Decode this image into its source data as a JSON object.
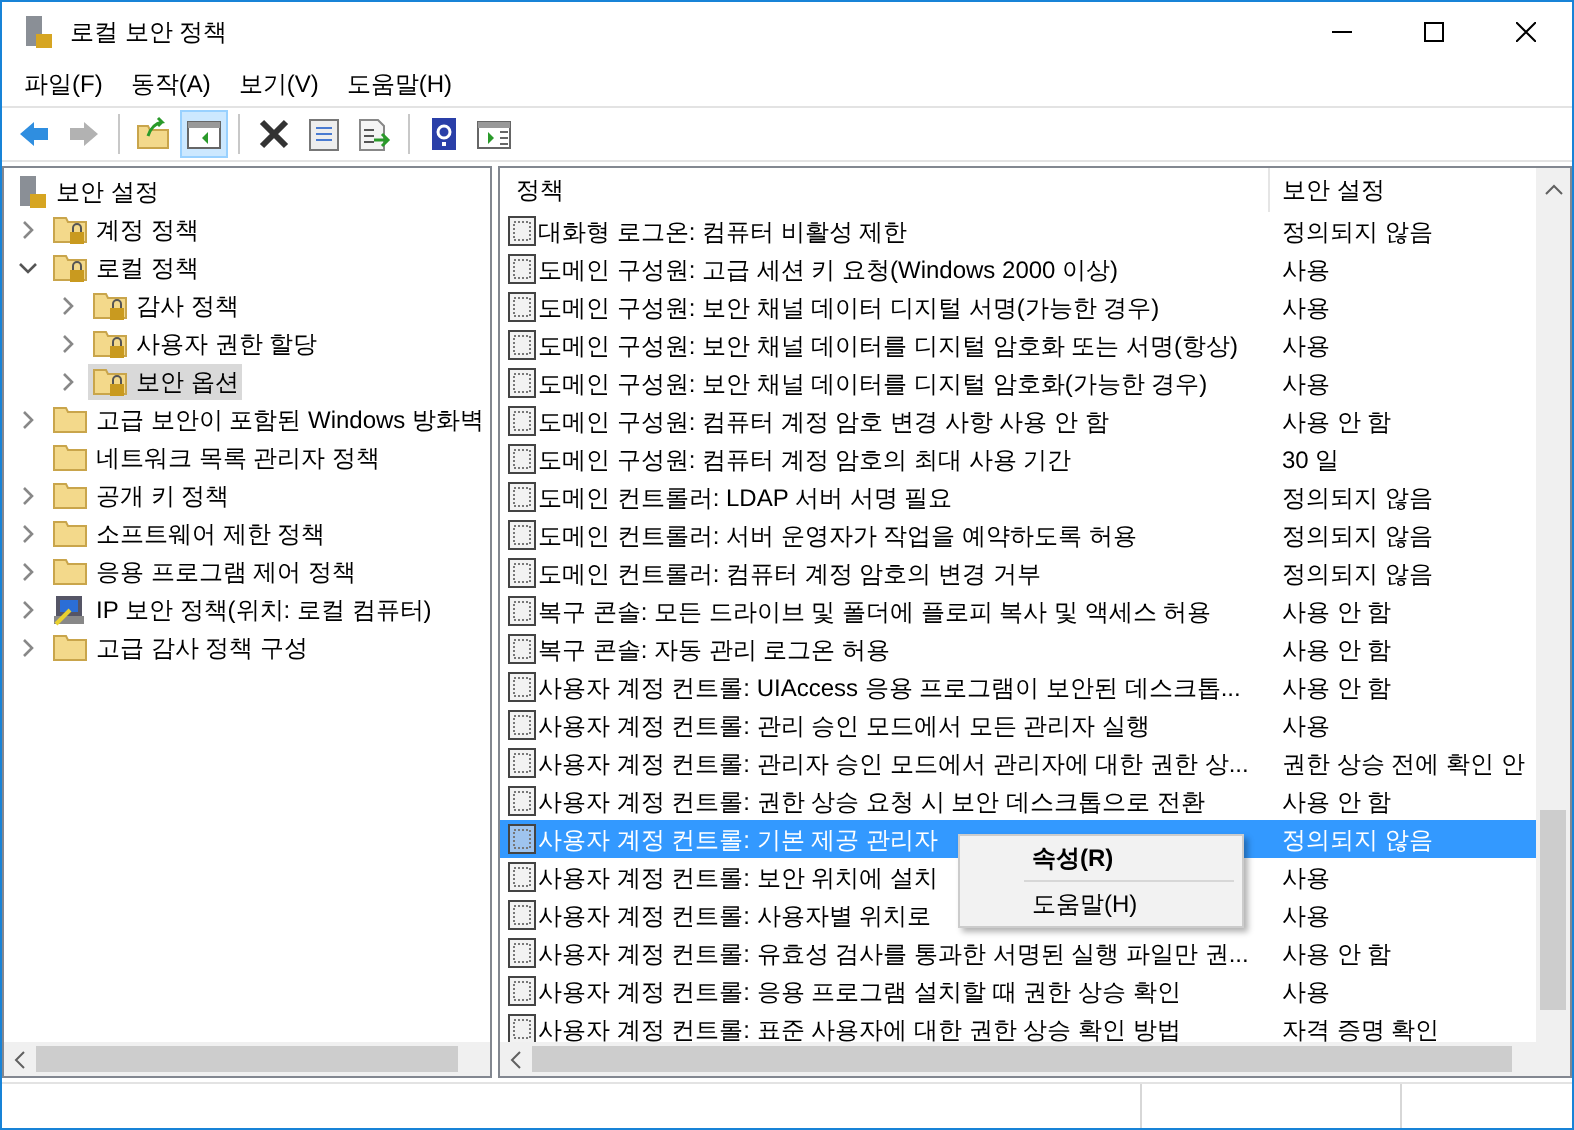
{
  "window": {
    "title": "로컬 보안 정책"
  },
  "menu": [
    "파일(F)",
    "동작(A)",
    "보기(V)",
    "도움말(H)"
  ],
  "toolbar": [
    [
      {
        "kind": "back",
        "disabled": false,
        "pressed": false
      },
      {
        "kind": "forward",
        "disabled": true,
        "pressed": false
      }
    ],
    [
      {
        "kind": "up",
        "disabled": false,
        "pressed": false
      },
      {
        "kind": "tree",
        "disabled": false,
        "pressed": true
      }
    ],
    [
      {
        "kind": "delete",
        "disabled": false,
        "pressed": false
      },
      {
        "kind": "properties",
        "disabled": false,
        "pressed": false
      },
      {
        "kind": "export",
        "disabled": false,
        "pressed": false
      }
    ],
    [
      {
        "kind": "help",
        "disabled": false,
        "pressed": false
      },
      {
        "kind": "action",
        "disabled": false,
        "pressed": false
      }
    ]
  ],
  "tree": {
    "label": "보안 설정",
    "children": [
      {
        "label": "계정 정책",
        "kind": "lockfolder",
        "expandable": true,
        "expanded": false,
        "selected": false
      },
      {
        "label": "로컬 정책",
        "kind": "lockfolder",
        "expandable": true,
        "expanded": true,
        "selected": false,
        "children": [
          {
            "label": "감사 정책",
            "kind": "lockfolder",
            "expandable": true,
            "expanded": false,
            "selected": false
          },
          {
            "label": "사용자 권한 할당",
            "kind": "lockfolder",
            "expandable": true,
            "expanded": false,
            "selected": false
          },
          {
            "label": "보안 옵션",
            "kind": "lockfolder",
            "expandable": true,
            "expanded": false,
            "selected": true
          }
        ]
      },
      {
        "label": "고급 보안이 포함된 Windows 방화벽",
        "kind": "folder",
        "expandable": true,
        "expanded": false,
        "selected": false
      },
      {
        "label": "네트워크 목록 관리자 정책",
        "kind": "folder",
        "expandable": false,
        "selected": false
      },
      {
        "label": "공개 키 정책",
        "kind": "folder",
        "expandable": true,
        "expanded": false,
        "selected": false
      },
      {
        "label": "소프트웨어 제한 정책",
        "kind": "folder",
        "expandable": true,
        "expanded": false,
        "selected": false
      },
      {
        "label": "응용 프로그램 제어 정책",
        "kind": "folder",
        "expandable": true,
        "expanded": false,
        "selected": false
      },
      {
        "label": "IP 보안 정책(위치: 로컬 컴퓨터)",
        "kind": "ip",
        "expandable": true,
        "expanded": false,
        "selected": false
      },
      {
        "label": "고급 감사 정책 구성",
        "kind": "folder",
        "expandable": true,
        "expanded": false,
        "selected": false
      }
    ]
  },
  "table": {
    "columns": [
      "정책",
      "보안 설정"
    ],
    "rows": [
      {
        "policy": "대화형 로그온: 컴퓨터 비활성 제한",
        "setting": "정의되지 않음",
        "selected": false
      },
      {
        "policy": "도메인 구성원: 고급 세션 키 요청(Windows 2000 이상)",
        "setting": "사용",
        "selected": false
      },
      {
        "policy": "도메인 구성원: 보안 채널 데이터 디지털 서명(가능한 경우)",
        "setting": "사용",
        "selected": false
      },
      {
        "policy": "도메인 구성원: 보안 채널 데이터를 디지털 암호화 또는 서명(항상)",
        "setting": "사용",
        "selected": false
      },
      {
        "policy": "도메인 구성원: 보안 채널 데이터를 디지털 암호화(가능한 경우)",
        "setting": "사용",
        "selected": false
      },
      {
        "policy": "도메인 구성원: 컴퓨터 계정 암호 변경 사항 사용 안 함",
        "setting": "사용 안 함",
        "selected": false
      },
      {
        "policy": "도메인 구성원: 컴퓨터 계정 암호의 최대 사용 기간",
        "setting": "30 일",
        "selected": false
      },
      {
        "policy": "도메인 컨트롤러: LDAP 서버 서명 필요",
        "setting": "정의되지 않음",
        "selected": false
      },
      {
        "policy": "도메인 컨트롤러: 서버 운영자가 작업을 예약하도록 허용",
        "setting": "정의되지 않음",
        "selected": false
      },
      {
        "policy": "도메인 컨트롤러: 컴퓨터 계정 암호의 변경 거부",
        "setting": "정의되지 않음",
        "selected": false
      },
      {
        "policy": "복구 콘솔: 모든 드라이브 및 폴더에 플로피 복사 및 액세스 허용",
        "setting": "사용 안 함",
        "selected": false
      },
      {
        "policy": "복구 콘솔: 자동 관리 로그온 허용",
        "setting": "사용 안 함",
        "selected": false
      },
      {
        "policy": "사용자 계정 컨트롤: UIAccess 응용 프로그램이 보안된 데스크톱...",
        "setting": "사용 안 함",
        "selected": false
      },
      {
        "policy": "사용자 계정 컨트롤: 관리 승인 모드에서 모든 관리자 실행",
        "setting": "사용",
        "selected": false
      },
      {
        "policy": "사용자 계정 컨트롤: 관리자 승인 모드에서 관리자에 대한 권한 상...",
        "setting": "권한 상승 전에 확인 안",
        "selected": false
      },
      {
        "policy": "사용자 계정 컨트롤: 권한 상승 요청 시 보안 데스크톱으로 전환",
        "setting": "사용 안 함",
        "selected": false
      },
      {
        "policy": "사용자 계정 컨트롤: 기본 제공 관리자",
        "setting": "정의되지 않음",
        "selected": true
      },
      {
        "policy": "사용자 계정 컨트롤: 보안 위치에 설치",
        "setting": "사용",
        "selected": false
      },
      {
        "policy": "사용자 계정 컨트롤: 사용자별 위치로",
        "setting": "사용",
        "selected": false
      },
      {
        "policy": "사용자 계정 컨트롤: 유효성 검사를 통과한 서명된 실행 파일만 권...",
        "setting": "사용 안 함",
        "selected": false
      },
      {
        "policy": "사용자 계정 컨트롤: 응용 프로그램 설치할 때 권한 상승 확인",
        "setting": "사용",
        "selected": false
      },
      {
        "policy": "사용자 계정 컨트롤: 표준 사용자에 대한 권한 상승 확인 방법",
        "setting": "자격 증명 확인",
        "selected": false
      }
    ]
  },
  "context_menu": [
    {
      "label": "속성(R)",
      "default": true
    },
    {
      "label": "도움말(H)",
      "default": false
    }
  ]
}
